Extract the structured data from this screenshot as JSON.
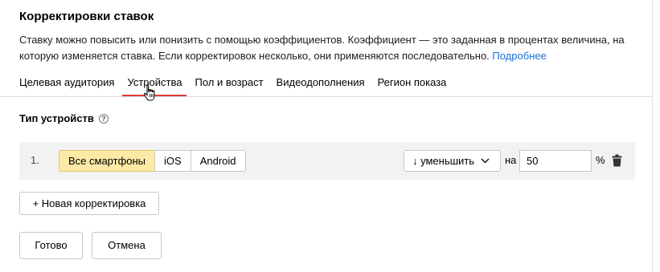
{
  "header": {
    "title": "Корректировки ставок",
    "description": "Ставку можно повысить или понизить с помощью коэффициентов. Коэффициент — это заданная в процентах величина, на которую изменяется ставка. Если корректировок несколько, они применяются последовательно.",
    "more_link": "Подробнее"
  },
  "tabs": [
    {
      "label": "Целевая аудитория",
      "active": false
    },
    {
      "label": "Устройства",
      "active": true
    },
    {
      "label": "Пол и возраст",
      "active": false
    },
    {
      "label": "Видеодополнения",
      "active": false
    },
    {
      "label": "Регион показа",
      "active": false
    }
  ],
  "section": {
    "label": "Тип устройств",
    "help_icon": "question-circle-icon"
  },
  "adjustment_row": {
    "index": "1.",
    "device_options": [
      {
        "label": "Все смартфоны",
        "selected": true
      },
      {
        "label": "iOS",
        "selected": false
      },
      {
        "label": "Android",
        "selected": false
      }
    ],
    "direction_select": "↓ уменьшить",
    "on_label": "на",
    "value": "50",
    "unit": "%",
    "delete_icon": "trash-icon"
  },
  "actions": {
    "add_label": "+ Новая корректировка",
    "done_label": "Готово",
    "cancel_label": "Отмена"
  },
  "colors": {
    "link": "#1a6fd6",
    "active_tab_underline": "#e23a3a",
    "selected_segment": "#fce9a6",
    "row_background": "#f2f2f2"
  }
}
